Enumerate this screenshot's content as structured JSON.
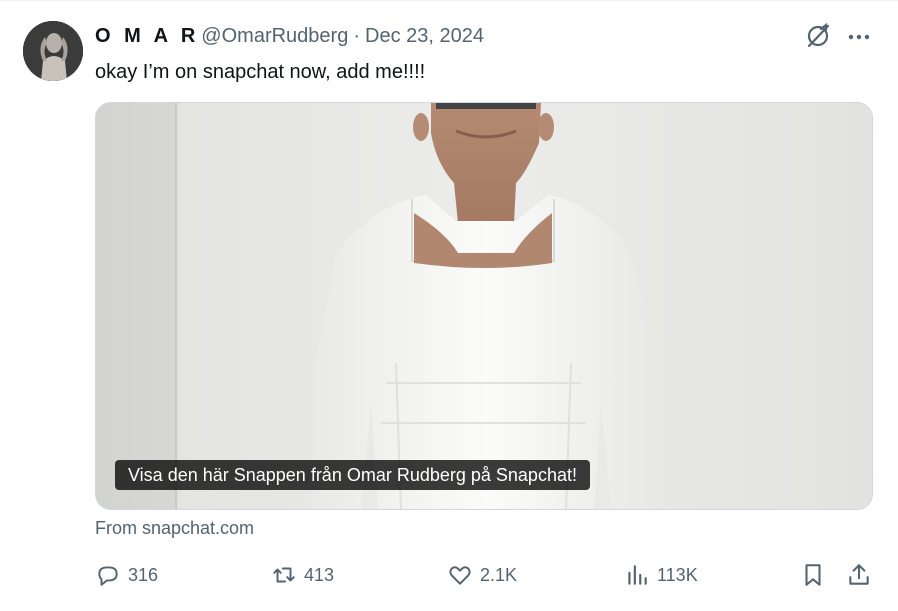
{
  "author": {
    "display_name": "O M A R",
    "handle": "@OmarRudberg",
    "separator": "·",
    "date": "Dec 23, 2024"
  },
  "tweet": {
    "text": "okay I’m on snapchat now, add me!!!!"
  },
  "media": {
    "caption": "Visa den här Snappen från Omar Rudberg på Snapchat!",
    "source": "From snapchat.com"
  },
  "actions": {
    "replies": "316",
    "reposts": "413",
    "likes": "2.1K",
    "views": "113K"
  },
  "icons": {
    "header": [
      "grok-icon",
      "more-icon"
    ],
    "actions": [
      "reply-icon",
      "repost-icon",
      "like-icon",
      "views-icon",
      "bookmark-icon",
      "share-icon"
    ]
  },
  "colors": {
    "text_primary": "#0f1419",
    "text_secondary": "#536471",
    "border": "#cfd9de",
    "background": "#ffffff"
  }
}
